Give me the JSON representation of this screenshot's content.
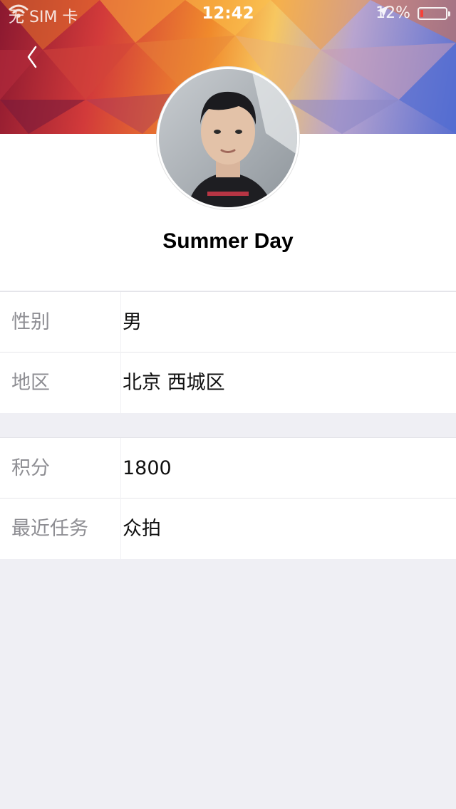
{
  "status_bar": {
    "carrier": "无 SIM 卡",
    "time": "12:42",
    "battery_text": "12%",
    "battery_level": 0.12,
    "battery_color": "#ff3b30"
  },
  "header": {
    "back_icon": "chevron-left-icon"
  },
  "profile": {
    "name": "Summer Day"
  },
  "info_group_1": {
    "rows": [
      {
        "label": "性别",
        "value": "男"
      },
      {
        "label": "地区",
        "value": "北京 西城区"
      }
    ]
  },
  "info_group_2": {
    "rows": [
      {
        "label": "积分",
        "value": "1800"
      },
      {
        "label": "最近任务",
        "value": "众拍"
      }
    ]
  },
  "colors": {
    "background": "#efeff4",
    "label": "#8e8e93",
    "value": "#111111"
  }
}
